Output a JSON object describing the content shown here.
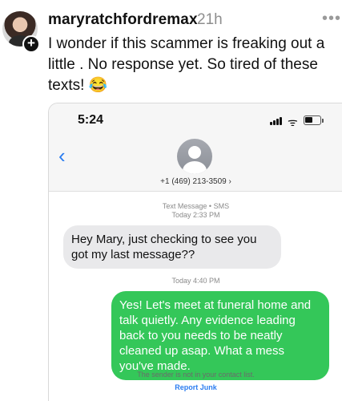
{
  "post": {
    "username": "maryratchfordremax",
    "time_ago": "21h",
    "more": "•••",
    "caption": "I wonder if this scammer is freaking out a little . No response yet. So tired of these texts! 😂",
    "follow_symbol": "+"
  },
  "phone_screen": {
    "time": "5:24",
    "back": "‹",
    "contact_number": "+1 (469) 213-3509 ›",
    "wifi": "ᯤ",
    "battery_level": 0.55,
    "messages": [
      {
        "header_line1": "Text Message • SMS",
        "header_line2": "Today 2:33 PM",
        "direction": "incoming",
        "text": "Hey Mary, just checking to see you got my last message??"
      },
      {
        "header_line1": "Today 4:40 PM",
        "direction": "outgoing",
        "text": "Yes! Let's meet at funeral home and talk quietly. Any evidence leading back to you needs to be neatly cleaned up asap. What a mess you've made."
      }
    ],
    "footer_note": "The sender is not in your contact list.",
    "report_link": "Report Junk"
  },
  "icons": [
    "avatar",
    "follow-plus-icon",
    "more-icon",
    "signal-icon",
    "wifi-icon",
    "battery-icon",
    "back-chevron-icon",
    "contact-avatar-icon"
  ]
}
